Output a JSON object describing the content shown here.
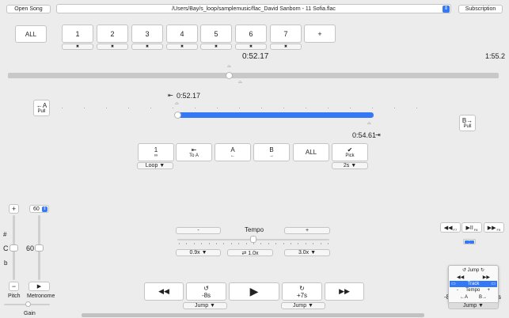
{
  "toolbar": {
    "open_song": "Open Song",
    "file_path": "/Users/Bay/s_loop/samplemusic/flac_David Sanborn - 11 Sofia.flac",
    "subscription": "Subscription"
  },
  "slots": {
    "all": "ALL",
    "items": [
      "1",
      "2",
      "3",
      "4",
      "5",
      "6",
      "7"
    ],
    "add": "+",
    "remove_glyph": "✖"
  },
  "playback": {
    "position": "0:52.17",
    "duration": "1:55.2",
    "progress_fraction": 0.45
  },
  "loop": {
    "left_button": {
      "glyph": "←A",
      "sub": "Pull"
    },
    "right_button": {
      "glyph": "B→",
      "sub": "Pull"
    },
    "start_time": "0:52.17",
    "start_glyph": "⇤",
    "end_time": "0:54.61",
    "end_glyph": "⇥",
    "region": [
      0.0,
      1.0
    ]
  },
  "loop_controls": {
    "buttons": [
      {
        "top": "1",
        "bottom": "∞"
      },
      {
        "top": "⇤",
        "bottom": "To A"
      },
      {
        "top": "A",
        "bottom": "←"
      },
      {
        "top": "B",
        "bottom": "→"
      },
      {
        "top": "ALL",
        "bottom": ""
      },
      {
        "top": "✔",
        "bottom": "Pick"
      }
    ],
    "loop_select": "Loop ▼",
    "pick_select": "2s ▼"
  },
  "pitch": {
    "plus": "+",
    "minus": "−",
    "sharp": "#",
    "note": "C",
    "flat": "b",
    "label": "Pitch",
    "gain_label": "Gain"
  },
  "metronome": {
    "bpm": "60",
    "value": "60",
    "play_glyph": "▶",
    "label": "Metronome"
  },
  "tempo": {
    "minus": "-",
    "label": "Tempo",
    "plus": "+",
    "presets": [
      "0.9x ▼",
      "⇄ 1.0x",
      "3.0x ▼"
    ],
    "level_fraction": 0.5
  },
  "transport": {
    "rewind": "◀◀",
    "back": {
      "glyph": "↺",
      "label": "-8s"
    },
    "play": "▶",
    "forward": {
      "glyph": "↻",
      "label": "+7s"
    },
    "fast_forward": "▶▶",
    "jump_left": "Jump ▼",
    "jump_right": "Jump ▼"
  },
  "right_panel": {
    "buttons": [
      {
        "glyph": "◀◀",
        "key": "F7"
      },
      {
        "glyph": "▶II",
        "key": "F8"
      },
      {
        "glyph": "▶▶",
        "key": "F9"
      }
    ],
    "menu": {
      "title": "Jump",
      "row1": [
        "◀◀",
        "▶▶"
      ],
      "track": "Track",
      "tempo": "Tempo",
      "row3": [
        "←A",
        "B→"
      ],
      "minus": "-",
      "plus": "+"
    },
    "partial_left": "-8",
    "partial_right": "s",
    "jump_select": "Jump ▼"
  },
  "colors": {
    "accent": "#3478f6",
    "background": "#ececec"
  }
}
